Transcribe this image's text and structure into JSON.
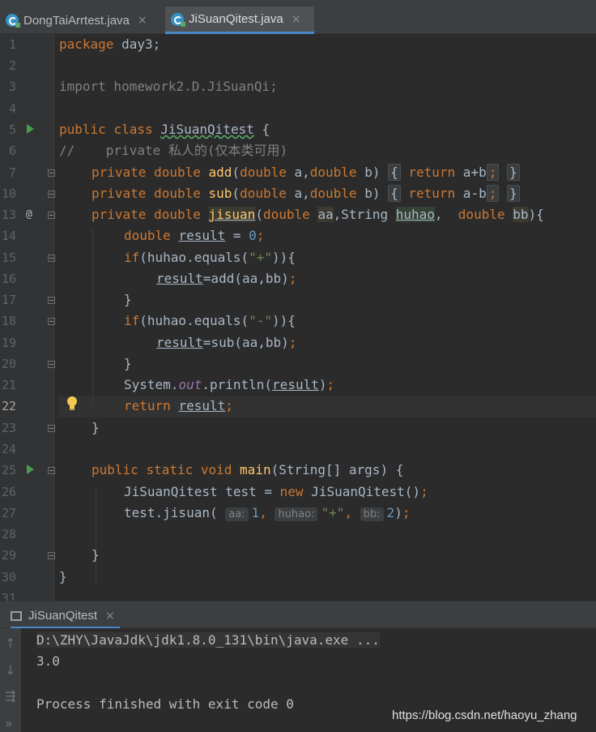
{
  "tabs": [
    {
      "label": "DongTaiArrtest.java",
      "active": false
    },
    {
      "label": "JiSuanQitest.java",
      "active": true
    }
  ],
  "close_glyph": "×",
  "gutter": {
    "line_numbers": [
      "1",
      "2",
      "3",
      "4",
      "5",
      "6",
      "7",
      "10",
      "13",
      "14",
      "15",
      "16",
      "17",
      "18",
      "19",
      "20",
      "21",
      "22",
      "23",
      "24",
      "25",
      "26",
      "27",
      "28",
      "29",
      "30",
      "31"
    ],
    "current_line": "22",
    "override_marker": "@"
  },
  "code": {
    "l1": [
      "package",
      " day3;"
    ],
    "l3": "import homework2.D.JiSuanQi;",
    "l5": [
      "public",
      " ",
      "class",
      " ",
      "JiSuanQitest",
      " {"
    ],
    "l6": "//    private 私人的(仅本类可用)",
    "l7": [
      "private",
      " ",
      "double",
      " ",
      "add",
      "(",
      "double",
      " a,",
      "double",
      " b) ",
      "{",
      " ",
      "return",
      " a+b",
      ";",
      " ",
      "}"
    ],
    "l10": [
      "private",
      " ",
      "double",
      " ",
      "sub",
      "(",
      "double",
      " a,",
      "double",
      " b) ",
      "{",
      " ",
      "return",
      " a-b",
      ";",
      " ",
      "}"
    ],
    "l13": [
      "private",
      " ",
      "double",
      " ",
      "jisuan",
      "(",
      "double",
      " ",
      "aa",
      ",String ",
      "huhao",
      ",  ",
      "double",
      " ",
      "bb",
      "){"
    ],
    "l14": [
      "double",
      " ",
      "result",
      " = ",
      "0",
      ";"
    ],
    "l15": [
      "if",
      "(huhao.equals(",
      "\"+\"",
      ")){"
    ],
    "l16": [
      "result",
      "=add(aa,bb)",
      ";"
    ],
    "l17": "}",
    "l18": [
      "if",
      "(huhao.equals(",
      "\"-\"",
      ")){"
    ],
    "l19": [
      "result",
      "=sub(aa,bb)",
      ";"
    ],
    "l20": "}",
    "l21": [
      "System.",
      "out",
      ".println(",
      "result",
      ")",
      ";"
    ],
    "l22": [
      "return",
      " ",
      "result",
      ";"
    ],
    "l23": "}",
    "l25": [
      "public",
      " ",
      "static",
      " ",
      "void",
      " ",
      "main",
      "(String[] args) {"
    ],
    "l26": [
      "JiSuanQitest test = ",
      "new",
      " JiSuanQitest()",
      ";"
    ],
    "l27": [
      "test.jisuan( ",
      "aa:",
      "1",
      ", ",
      "huhao:",
      "\"+\"",
      ", ",
      "bb:",
      "2",
      ")",
      ";"
    ],
    "l29": "}",
    "l30": "}"
  },
  "run_panel": {
    "tab_label": "JiSuanQitest",
    "lines": [
      "D:\\ZHY\\JavaJdk\\jdk1.8.0_131\\bin\\java.exe ...",
      "3.0",
      "",
      "Process finished with exit code 0"
    ],
    "arrows": [
      "↑",
      "↓",
      "⇶",
      "»"
    ]
  },
  "watermark": "https://blog.csdn.net/haoyu_zhang",
  "colors": {
    "background": "#2b2b2b",
    "keyword": "#cc7832",
    "method": "#ffc66d",
    "number": "#6897bb",
    "string": "#6a8759",
    "accent": "#4a88c7"
  }
}
